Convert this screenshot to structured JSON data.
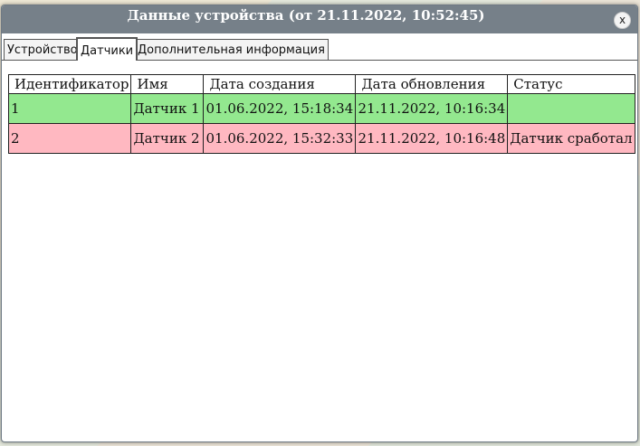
{
  "window": {
    "title": "Данные устройства (от 21.11.2022, 10:52:45)",
    "close_label": "x"
  },
  "tabs": [
    {
      "label": "Устройство",
      "active": false
    },
    {
      "label": "Датчики",
      "active": true
    },
    {
      "label": "Дополнительная информация",
      "active": false
    }
  ],
  "table": {
    "headers": [
      "Идентификатор",
      "Имя",
      "Дата создания",
      "Дата обновления",
      "Статус"
    ],
    "rows": [
      {
        "id": "1",
        "name": "Датчик 1",
        "created": "01.06.2022, 15:18:34",
        "updated": "21.11.2022, 10:16:34",
        "status": "",
        "row_color": "#93e88f"
      },
      {
        "id": "2",
        "name": "Датчик 2",
        "created": "01.06.2022, 15:32:33",
        "updated": "21.11.2022, 10:16:48",
        "status": "Датчик сработал",
        "row_color": "#ffb8c1"
      }
    ]
  },
  "colors": {
    "titlebar": "#768089",
    "ok_row": "#93e88f",
    "alarm_row": "#ffb8c1"
  }
}
